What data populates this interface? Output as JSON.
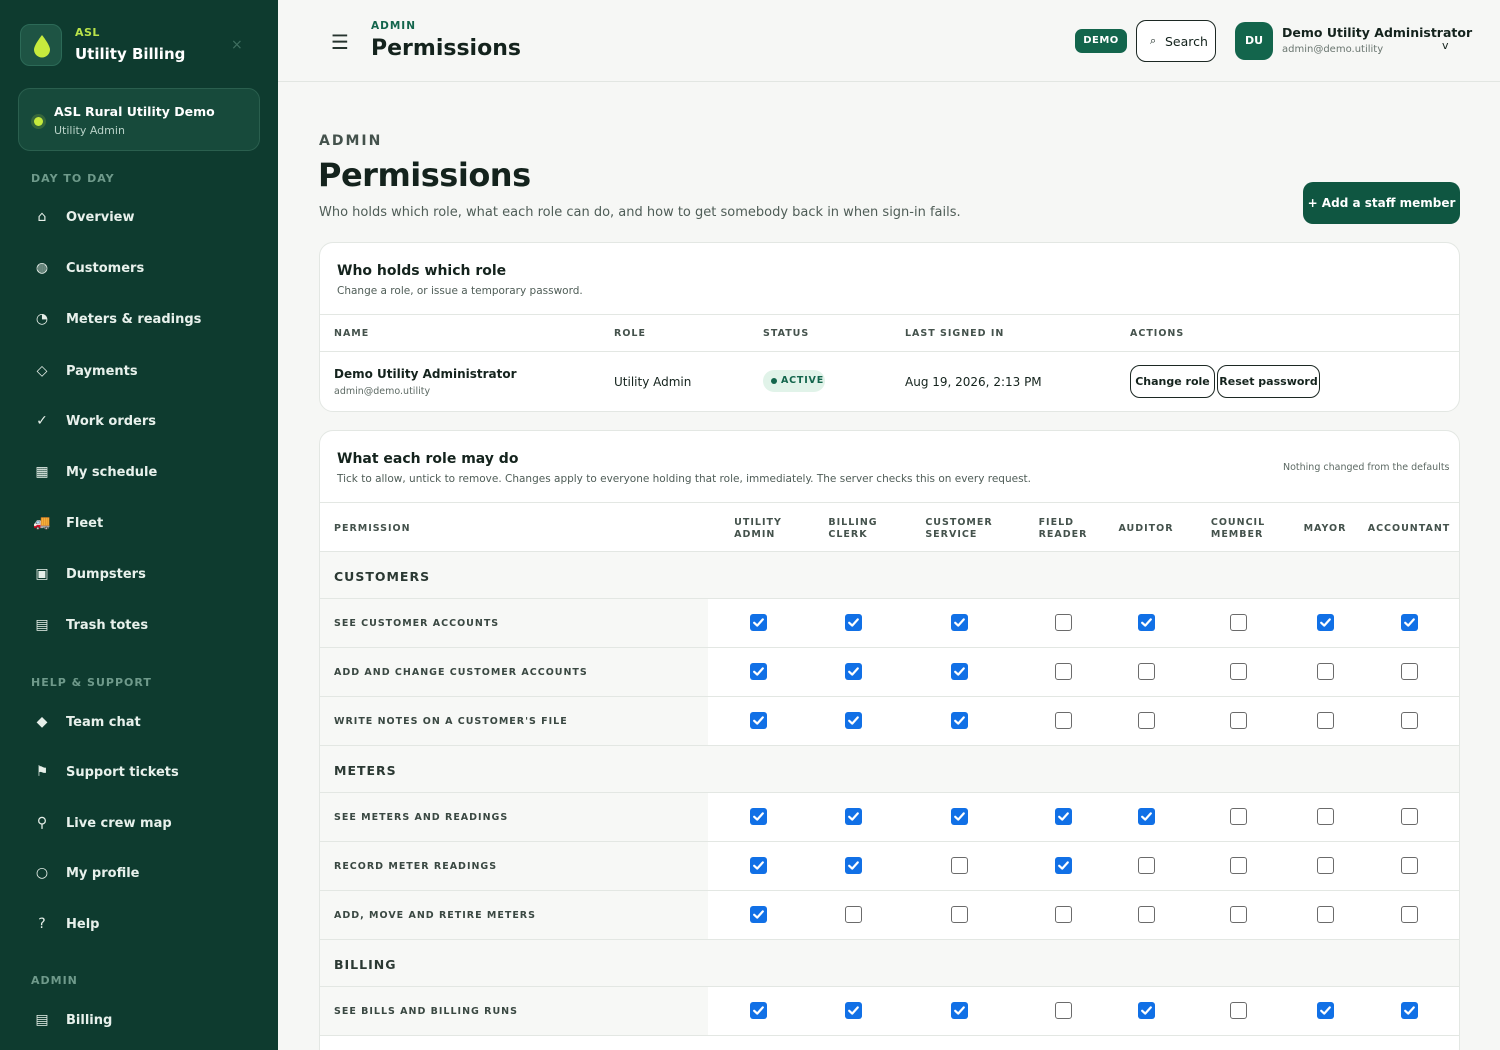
{
  "sidebar": {
    "brand_small": "ASL",
    "brand_title": "Utility Billing",
    "close_icon": "×",
    "org": {
      "name": "ASL Rural Utility Demo",
      "role": "Utility Admin"
    },
    "sections": [
      {
        "label": "DAY TO DAY",
        "items": [
          {
            "label": "Overview",
            "icon": "home-icon",
            "glyph": "⌂"
          },
          {
            "label": "Customers",
            "icon": "customers-icon",
            "glyph": "◍"
          },
          {
            "label": "Meters & readings",
            "icon": "gauge-icon",
            "glyph": "◔"
          },
          {
            "label": "Payments",
            "icon": "payments-icon",
            "glyph": "◇"
          },
          {
            "label": "Work orders",
            "icon": "check-icon",
            "glyph": "✓"
          },
          {
            "label": "My schedule",
            "icon": "calendar-icon",
            "glyph": "▦"
          },
          {
            "label": "Fleet",
            "icon": "truck-icon",
            "glyph": "🚚"
          },
          {
            "label": "Dumpsters",
            "icon": "dumpster-icon",
            "glyph": "▣"
          },
          {
            "label": "Trash totes",
            "icon": "tote-icon",
            "glyph": "▤"
          }
        ]
      },
      {
        "label": "HELP & SUPPORT",
        "items": [
          {
            "label": "Team chat",
            "icon": "chat-icon",
            "glyph": "◆"
          },
          {
            "label": "Support tickets",
            "icon": "flag-icon",
            "glyph": "⚑"
          },
          {
            "label": "Live crew map",
            "icon": "map-pin-icon",
            "glyph": "⚲"
          },
          {
            "label": "My profile",
            "icon": "profile-icon",
            "glyph": "○"
          },
          {
            "label": "Help",
            "icon": "help-icon",
            "glyph": "?"
          }
        ]
      },
      {
        "label": "ADMIN",
        "items": [
          {
            "label": "Billing",
            "icon": "billing-icon",
            "glyph": "▤"
          }
        ]
      }
    ]
  },
  "topbar": {
    "menu_glyph": "☰",
    "eyebrow": "ADMIN",
    "title": "Permissions",
    "demo_badge": "DEMO",
    "search_glyph": "⌕",
    "search_label": "Search",
    "user": {
      "initials": "DU",
      "name": "Demo Utility Administrator",
      "email": "admin@demo.utility",
      "caret": "v"
    }
  },
  "page": {
    "eyebrow": "ADMIN",
    "title": "Permissions",
    "subtitle": "Who holds which role, what each role can do, and how to get somebody back in when sign-in fails.",
    "add_button": "+  Add a staff member"
  },
  "roles_card": {
    "title": "Who holds which role",
    "subtitle": "Change a role, or issue a temporary password.",
    "columns": [
      "NAME",
      "ROLE",
      "STATUS",
      "LAST SIGNED IN",
      "ACTIONS"
    ],
    "row": {
      "name": "Demo Utility Administrator",
      "email": "admin@demo.utility",
      "role": "Utility Admin",
      "status": "ACTIVE",
      "last_signed_in": "Aug 19, 2026, 2:13 PM",
      "change_role": "Change role",
      "reset_password": "Reset password"
    }
  },
  "perms_card": {
    "title": "What each role may do",
    "subtitle": "Tick to allow, untick to remove. Changes apply to everyone holding that role, immediately. The server checks this on every request.",
    "note": "Nothing changed from the defaults",
    "perm_header": "PERMISSION",
    "roles": [
      {
        "l1": "UTILITY",
        "l2": "ADMIN"
      },
      {
        "l1": "BILLING",
        "l2": "CLERK"
      },
      {
        "l1": "CUSTOMER",
        "l2": "SERVICE"
      },
      {
        "l1": "FIELD",
        "l2": "READER"
      },
      {
        "l1": "AUDITOR",
        "l2": ""
      },
      {
        "l1": "COUNCIL",
        "l2": "MEMBER"
      },
      {
        "l1": "MAYOR",
        "l2": ""
      },
      {
        "l1": "ACCOUNTANT",
        "l2": ""
      }
    ],
    "groups": [
      {
        "label": "CUSTOMERS",
        "rows": [
          {
            "label": "SEE CUSTOMER ACCOUNTS",
            "checks": [
              true,
              true,
              true,
              false,
              true,
              false,
              true,
              true
            ]
          },
          {
            "label": "ADD AND CHANGE CUSTOMER ACCOUNTS",
            "checks": [
              true,
              true,
              true,
              false,
              false,
              false,
              false,
              false
            ]
          },
          {
            "label": "WRITE NOTES ON A CUSTOMER'S FILE",
            "checks": [
              true,
              true,
              true,
              false,
              false,
              false,
              false,
              false
            ]
          }
        ]
      },
      {
        "label": "METERS",
        "rows": [
          {
            "label": "SEE METERS AND READINGS",
            "checks": [
              true,
              true,
              true,
              true,
              true,
              false,
              false,
              false
            ]
          },
          {
            "label": "RECORD METER READINGS",
            "checks": [
              true,
              true,
              false,
              true,
              false,
              false,
              false,
              false
            ]
          },
          {
            "label": "ADD, MOVE AND RETIRE METERS",
            "checks": [
              true,
              false,
              false,
              false,
              false,
              false,
              false,
              false
            ]
          }
        ]
      },
      {
        "label": "BILLING",
        "rows": [
          {
            "label": "SEE BILLS AND BILLING RUNS",
            "checks": [
              true,
              true,
              true,
              false,
              true,
              false,
              true,
              true
            ]
          }
        ]
      }
    ]
  },
  "colors": {
    "sidebar_bg": "#0e3b2f",
    "accent": "#13654c",
    "lime": "#c6ea3d",
    "checkbox": "#1170e6"
  }
}
